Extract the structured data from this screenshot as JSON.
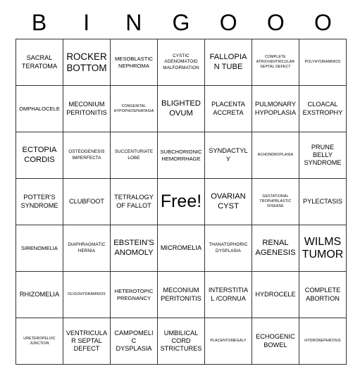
{
  "header": {
    "letters": [
      "B",
      "I",
      "N",
      "G",
      "O",
      "O",
      "O"
    ]
  },
  "grid": {
    "columns": 7,
    "rows": 7,
    "cells": [
      {
        "text": "SACRAL TERATOMA",
        "size": "m"
      },
      {
        "text": "ROCKER BOTTOM",
        "size": "xl"
      },
      {
        "text": "MESOBLASTIC NEPHROMA",
        "size": "s"
      },
      {
        "text": "CYSTIC ADENOMATOID MALFORMATION",
        "size": "xs"
      },
      {
        "text": "FALLOPIAN TUBE",
        "size": "l"
      },
      {
        "text": "COMPLETE ATRIOVENTRICULAR SEPTAL DEFECT",
        "size": "xxs"
      },
      {
        "text": "POLYHYDRAMNIOS",
        "size": "xxs"
      },
      {
        "text": "OMPHALOCELE",
        "size": "s"
      },
      {
        "text": "MECONIUM PERITONITIS",
        "size": "m"
      },
      {
        "text": "CONGENITAL HYPOPHOSPHATASIA",
        "size": "xxs"
      },
      {
        "text": "BLIGHTED OVUM",
        "size": "l"
      },
      {
        "text": "PLACENTA ACCRETA",
        "size": "m"
      },
      {
        "text": "PULMONARY HYPOPLASIA",
        "size": "m"
      },
      {
        "text": "CLOACAL EXSTROPHY",
        "size": "m"
      },
      {
        "text": "ECTOPIA CORDIS",
        "size": "l"
      },
      {
        "text": "OSTEOGENESIS IMPERFECTA",
        "size": "xs"
      },
      {
        "text": "SUCCENTURIATE LOBE",
        "size": "xs"
      },
      {
        "text": "SUBCHORIONIC HEMORRHAGE",
        "size": "s"
      },
      {
        "text": "SYNDACTYLY",
        "size": "m"
      },
      {
        "text": "ACHONDROPLASIA",
        "size": "xxs"
      },
      {
        "text": "PRUNE BELLY SYNDROME",
        "size": "m"
      },
      {
        "text": "POTTER'S SYNDROME",
        "size": "m"
      },
      {
        "text": "CLUBFOOT",
        "size": "m"
      },
      {
        "text": "TETRALOGY OF FALLOT",
        "size": "m"
      },
      {
        "text": "Free!",
        "size": "free"
      },
      {
        "text": "OVARIAN CYST",
        "size": "l"
      },
      {
        "text": "GESTATIONAL TROPHPBLASTIC DISEASE",
        "size": "xxs"
      },
      {
        "text": "PYLECTASIS",
        "size": "m"
      },
      {
        "text": "SIRENOMELIA",
        "size": "s"
      },
      {
        "text": "DIAPHRAGMATIC HERNIA",
        "size": "xs"
      },
      {
        "text": "EBSTEIN'S ANOMOLY",
        "size": "l"
      },
      {
        "text": "MICROMELIA",
        "size": "m"
      },
      {
        "text": "THANATOPHORIC DYSPLASIA",
        "size": "xs"
      },
      {
        "text": "RENAL AGENESIS",
        "size": "l"
      },
      {
        "text": "WILMS TUMOR",
        "size": "xxl"
      },
      {
        "text": "RHIZOMELIA",
        "size": "m"
      },
      {
        "text": "OLIGOHYDRAMNIOS",
        "size": "xxs"
      },
      {
        "text": "HETEROTOPIC PREGNANCY",
        "size": "s"
      },
      {
        "text": "MECONIUM PERITONITIS",
        "size": "m"
      },
      {
        "text": "INTERSTITIAL /CORNUA",
        "size": "m"
      },
      {
        "text": "HYDROCELE",
        "size": "m"
      },
      {
        "text": "COMPLETE ABORTION",
        "size": "m"
      },
      {
        "text": "URETEROPELVIC JUNCTION",
        "size": "xxs"
      },
      {
        "text": "VENTRICULAR SEPTAL DEFECT",
        "size": "m"
      },
      {
        "text": "CAMPOMELIC DYSPLASIA",
        "size": "m"
      },
      {
        "text": "UMBILICAL CORD STRICTURES",
        "size": "m"
      },
      {
        "text": "PLACENTOMEGALY",
        "size": "xxs"
      },
      {
        "text": "ECHOGENIC BOWEL",
        "size": "m"
      },
      {
        "text": "HYDRONEPHROSIS",
        "size": "xxs"
      }
    ]
  },
  "colors": {
    "background": "#ffffff",
    "border": "#333333",
    "text": "#000000"
  }
}
